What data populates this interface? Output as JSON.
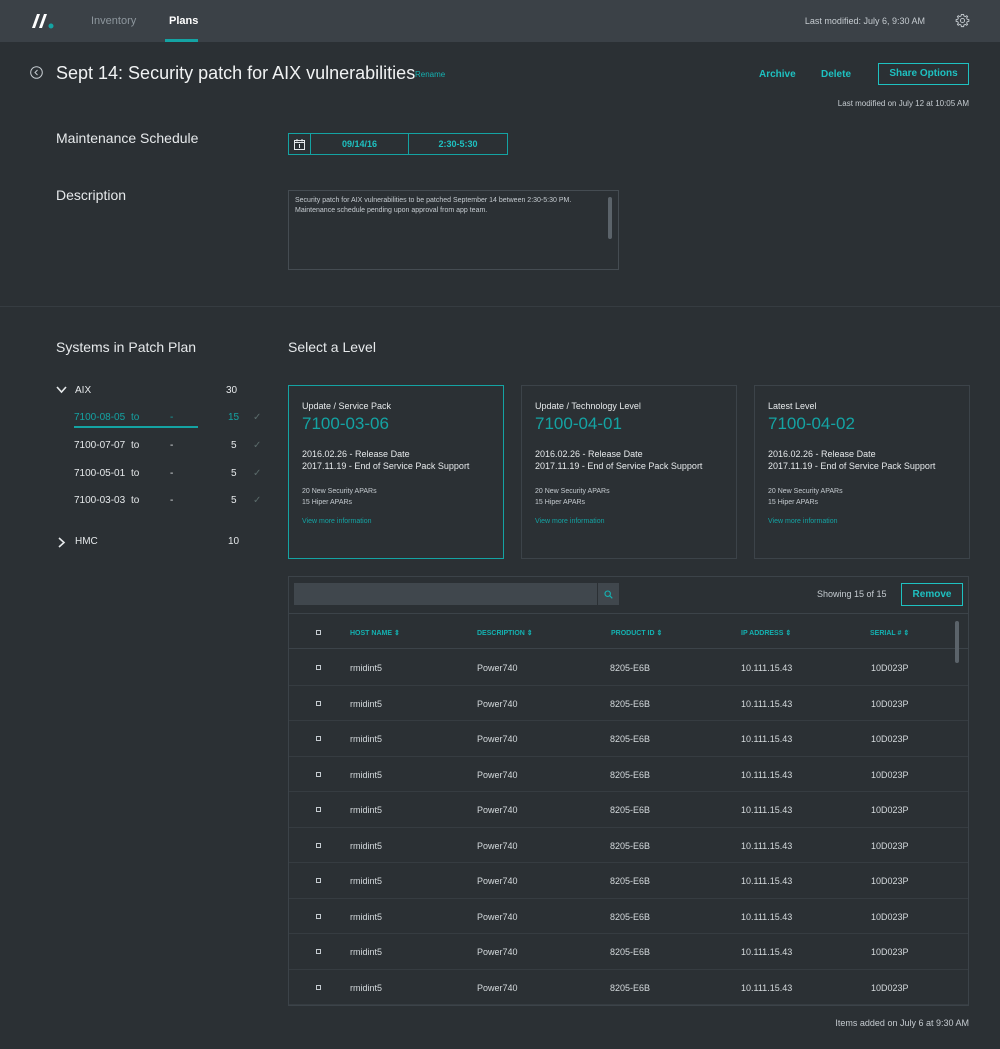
{
  "nav": {
    "tabs": [
      {
        "label": "Inventory",
        "active": false
      },
      {
        "label": "Plans",
        "active": true
      }
    ],
    "last_modified": "Last modified: July 6, 9:30 AM",
    "settings_icon": "gear-icon",
    "accent_color": "#14a3a3"
  },
  "header": {
    "title": "Sept 14: Security patch for AIX vulnerabilities",
    "rename_label": "Rename",
    "archive_label": "Archive",
    "delete_label": "Delete",
    "share_label": "Share Options",
    "modified_sub": "Last modified on July 12 at 10:05 AM"
  },
  "schedule": {
    "label": "Maintenance Schedule",
    "date": "09/14/16",
    "time": "2:30-5:30"
  },
  "description": {
    "label": "Description",
    "text": "Security patch for AIX vulnerabilities to be patched September 14 between 2:30-5:30 PM. Maintenance schedule pending upon approval from app team."
  },
  "systems": {
    "label": "Systems in Patch Plan",
    "groups": [
      {
        "name": "AIX",
        "count": "30",
        "expanded": true,
        "items": [
          {
            "level": "7100-08-05",
            "to": "to",
            "target": "-",
            "count": "15",
            "selected": true
          },
          {
            "level": "7100-07-07",
            "to": "to",
            "target": "-",
            "count": "5",
            "selected": false
          },
          {
            "level": "7100-05-01",
            "to": "to",
            "target": "-",
            "count": "5",
            "selected": false
          },
          {
            "level": "7100-03-03",
            "to": "to",
            "target": "-",
            "count": "5",
            "selected": false
          }
        ]
      },
      {
        "name": "HMC",
        "count": "10",
        "expanded": false,
        "items": []
      }
    ]
  },
  "levels": {
    "label": "Select a Level",
    "cards": [
      {
        "type": "Update / Service Pack",
        "version": "7100-03-06",
        "release": "2016.02.26 - Release Date",
        "eos": "2017.11.19 - End of Service Pack Support",
        "security": "20 New Security APARs",
        "hiper": "15 Hiper APARs",
        "more": "View more information",
        "selected": true
      },
      {
        "type": "Update / Technology Level",
        "version": "7100-04-01",
        "release": "2016.02.26 - Release Date",
        "eos": "2017.11.19 - End of Service Pack Support",
        "security": "20 New Security APARs",
        "hiper": "15 Hiper APARs",
        "more": "View more information",
        "selected": false
      },
      {
        "type": "Latest Level",
        "version": "7100-04-02",
        "release": "2016.02.26 - Release Date",
        "eos": "2017.11.19 - End of Service Pack Support",
        "security": "20 New Security APARs",
        "hiper": "15 Hiper APARs",
        "more": "View more information",
        "selected": false
      }
    ]
  },
  "table": {
    "search_value": "",
    "showing": "Showing 15 of 15",
    "remove_label": "Remove",
    "columns": [
      "HOST NAME",
      "DESCRIPTION",
      "PRODUCT ID",
      "IP ADDRESS",
      "SERIAL #"
    ],
    "rows": [
      [
        "rmidint5",
        "Power740",
        "8205-E6B",
        "10.111.15.43",
        "10D023P"
      ],
      [
        "rmidint5",
        "Power740",
        "8205-E6B",
        "10.111.15.43",
        "10D023P"
      ],
      [
        "rmidint5",
        "Power740",
        "8205-E6B",
        "10.111.15.43",
        "10D023P"
      ],
      [
        "rmidint5",
        "Power740",
        "8205-E6B",
        "10.111.15.43",
        "10D023P"
      ],
      [
        "rmidint5",
        "Power740",
        "8205-E6B",
        "10.111.15.43",
        "10D023P"
      ],
      [
        "rmidint5",
        "Power740",
        "8205-E6B",
        "10.111.15.43",
        "10D023P"
      ],
      [
        "rmidint5",
        "Power740",
        "8205-E6B",
        "10.111.15.43",
        "10D023P"
      ],
      [
        "rmidint5",
        "Power740",
        "8205-E6B",
        "10.111.15.43",
        "10D023P"
      ],
      [
        "rmidint5",
        "Power740",
        "8205-E6B",
        "10.111.15.43",
        "10D023P"
      ],
      [
        "rmidint5",
        "Power740",
        "8205-E6B",
        "10.111.15.43",
        "10D023P"
      ]
    ]
  },
  "footer": {
    "note": "Items added on July 6 at 9:30 AM"
  }
}
